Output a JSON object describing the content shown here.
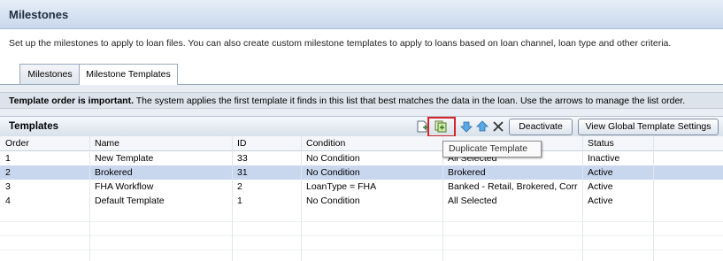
{
  "header": {
    "title": "Milestones"
  },
  "description": "Set up the milestones to apply to loan files. You can also create custom milestone templates to apply to loans based on loan channel, loan type and other criteria.",
  "tabs": [
    {
      "label": "Milestones",
      "active": false
    },
    {
      "label": "Milestone Templates",
      "active": true
    }
  ],
  "notice": {
    "bold": "Template order is important.",
    "text": " The system applies the first template it finds in this list that best matches the data in the loan. Use the arrows to manage the list order."
  },
  "grid": {
    "title": "Templates",
    "toolbar": {
      "icons": [
        "new-template-icon",
        "duplicate-template-icon",
        "move-down-icon",
        "move-up-icon",
        "delete-icon"
      ],
      "deactivate_label": "Deactivate",
      "global_settings_label": "View Global Template Settings"
    },
    "columns": [
      "Order",
      "Name",
      "ID",
      "Condition",
      "",
      "Status"
    ],
    "rows": [
      {
        "order": "1",
        "name": "New Template",
        "id": "33",
        "condition": "No Condition",
        "channel": "All Selected",
        "status": "Inactive",
        "selected": false
      },
      {
        "order": "2",
        "name": "Brokered",
        "id": "31",
        "condition": "No Condition",
        "channel": "Brokered",
        "status": "Active",
        "selected": true
      },
      {
        "order": "3",
        "name": "FHA Workflow",
        "id": "2",
        "condition": "LoanType = FHA",
        "channel": "Banked - Retail, Brokered, Corr",
        "status": "Active",
        "selected": false
      },
      {
        "order": "4",
        "name": "Default Template",
        "id": "1",
        "condition": "No Condition",
        "channel": "All Selected",
        "status": "Active",
        "selected": false
      }
    ]
  },
  "tooltip": "Duplicate Template",
  "colors": {
    "selected_row": "#c8d7ee",
    "highlight": "#d6262a",
    "header_bg": "#c9d8ec"
  }
}
